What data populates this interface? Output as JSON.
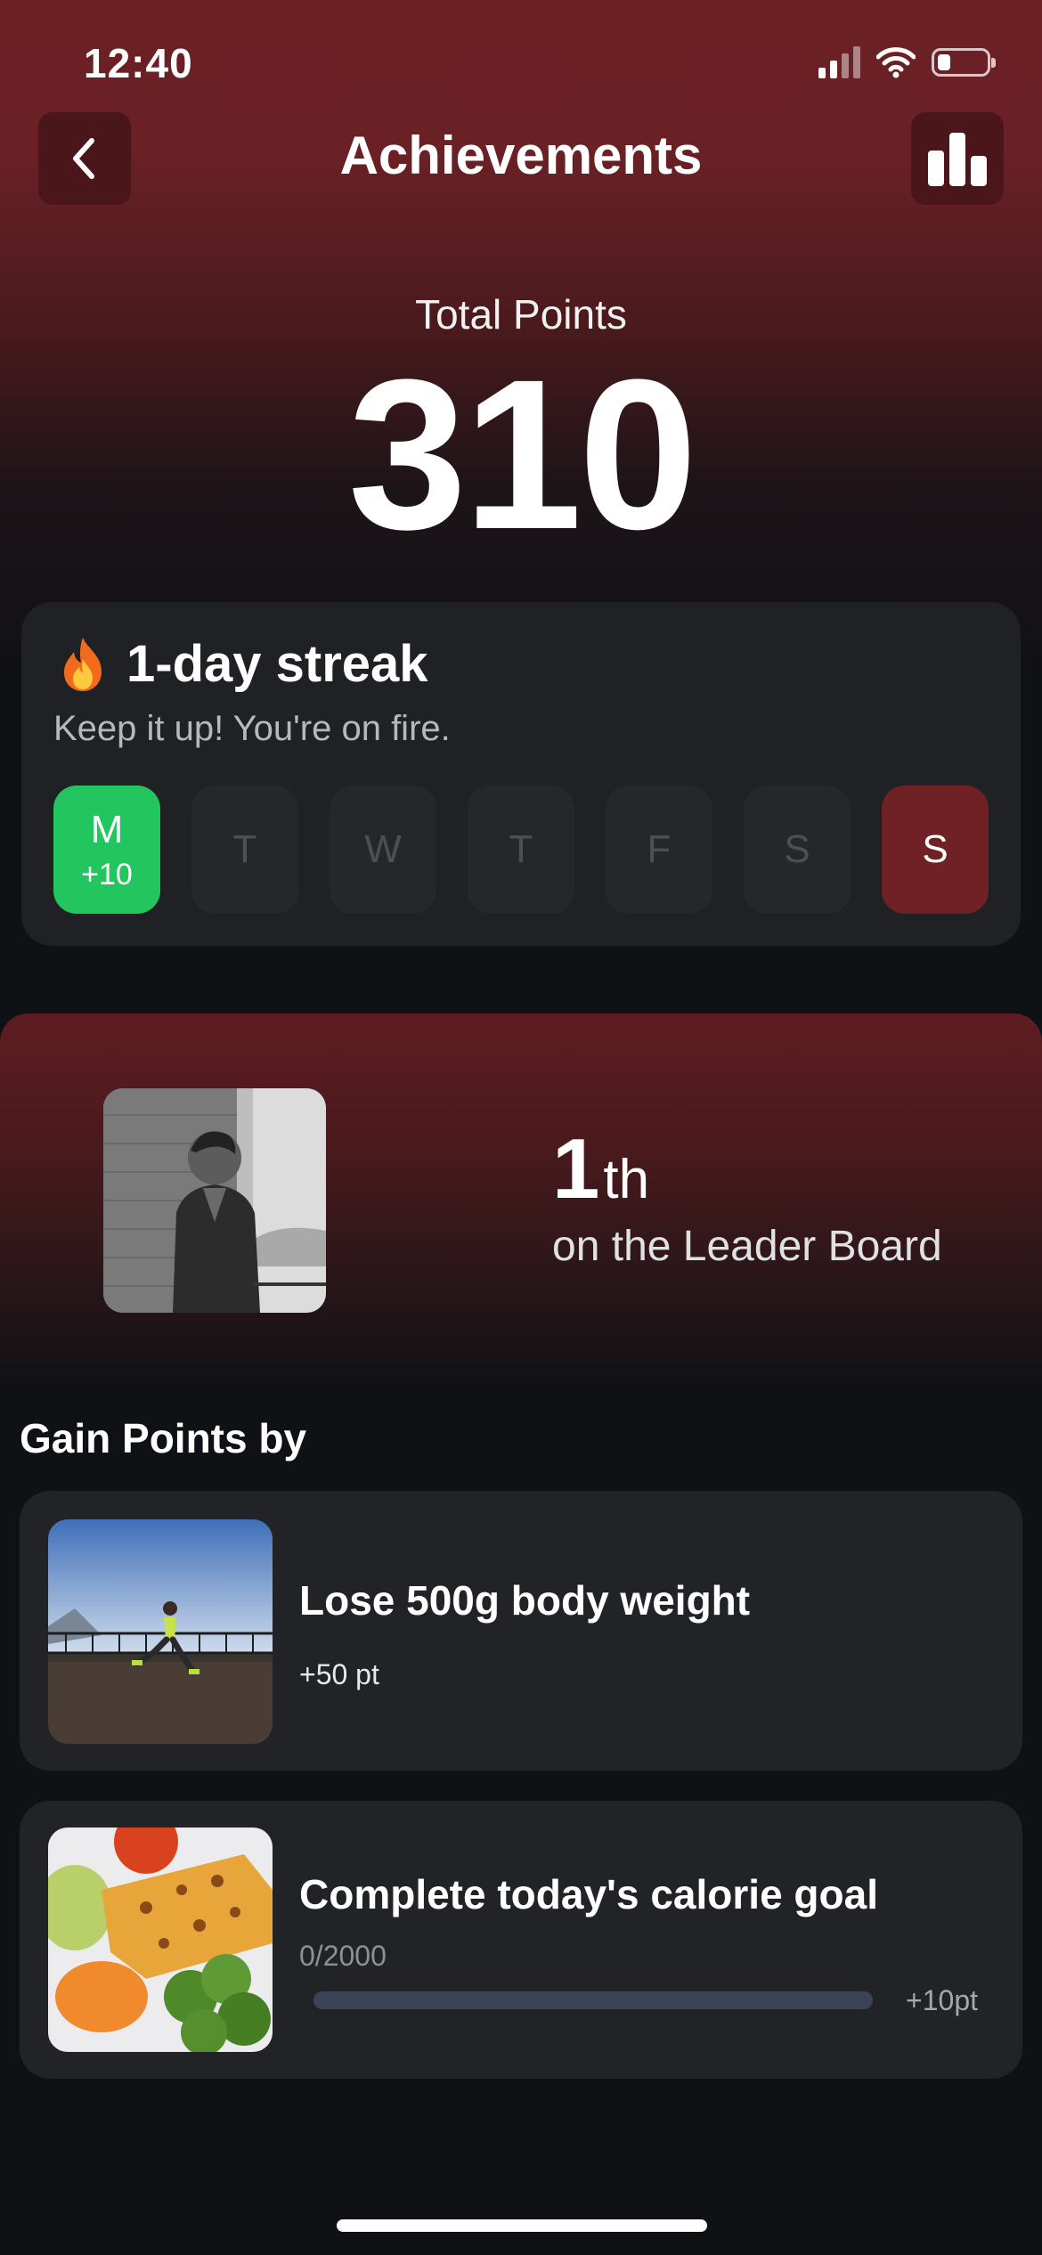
{
  "status_bar": {
    "time": "12:40"
  },
  "header": {
    "title": "Achievements",
    "back_icon": "chevron-left-icon",
    "stats_icon": "bar-chart-icon"
  },
  "points": {
    "label": "Total Points",
    "value": "310"
  },
  "streak": {
    "title": "1-day streak",
    "subtitle": "Keep it up! You're on fire.",
    "days": [
      {
        "letter": "M",
        "points": "+10",
        "state": "completed"
      },
      {
        "letter": "T",
        "points": "",
        "state": "inactive"
      },
      {
        "letter": "W",
        "points": "",
        "state": "inactive"
      },
      {
        "letter": "T",
        "points": "",
        "state": "inactive"
      },
      {
        "letter": "F",
        "points": "",
        "state": "inactive"
      },
      {
        "letter": "S",
        "points": "",
        "state": "inactive"
      },
      {
        "letter": "S",
        "points": "",
        "state": "today"
      }
    ]
  },
  "leaderboard": {
    "rank": "1",
    "suffix": "th",
    "label": "on the Leader Board"
  },
  "gain": {
    "title": "Gain Points by",
    "tasks": [
      {
        "title": "Lose 500g body weight",
        "points": "+50 pt"
      },
      {
        "title": "Complete today's calorie goal",
        "progress_text": "0/2000",
        "progress": 0,
        "bonus": "+10pt"
      }
    ]
  },
  "colors": {
    "accent_red": "#6f2125",
    "success_green": "#22c55e",
    "card_bg": "#202125"
  }
}
